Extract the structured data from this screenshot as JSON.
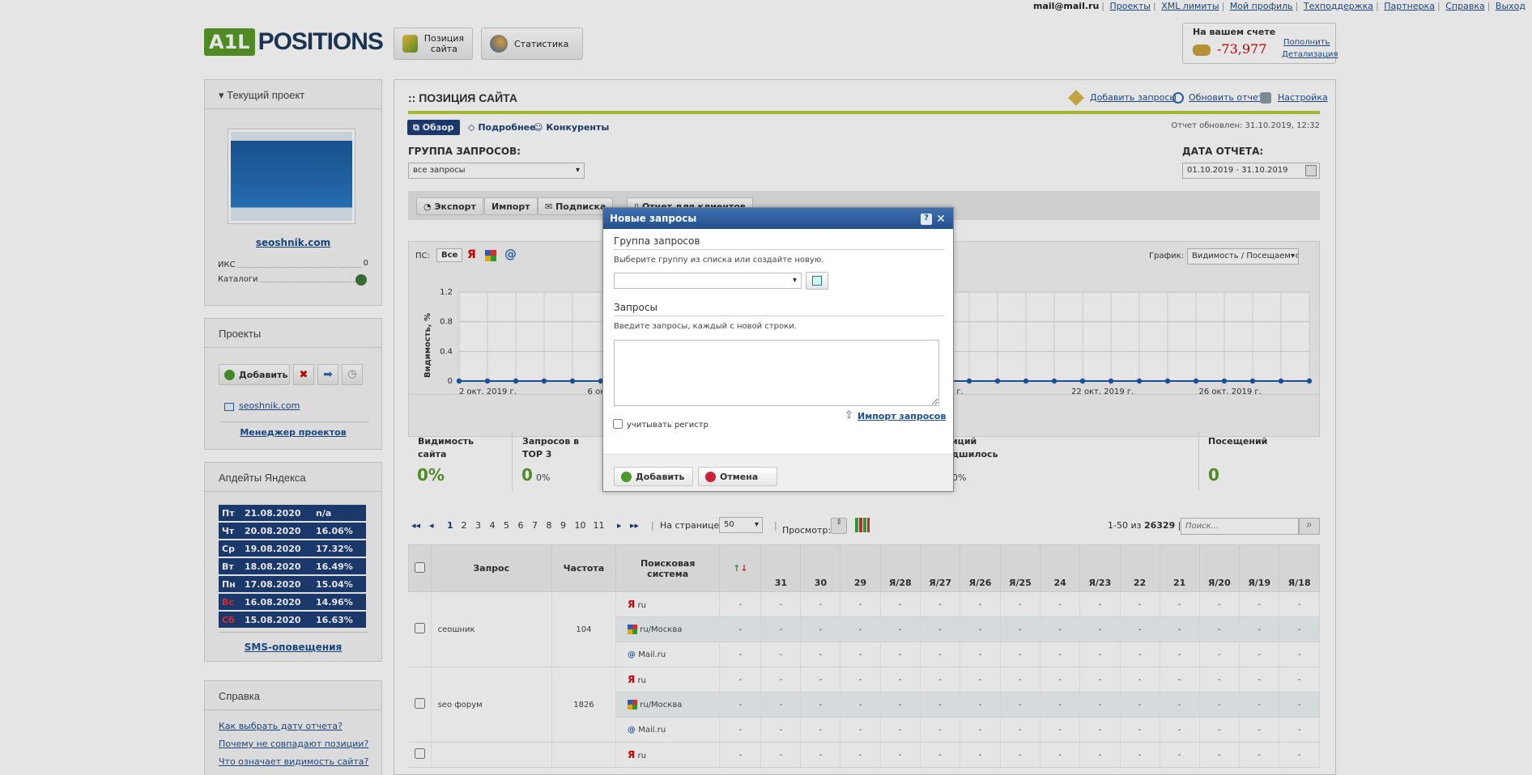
{
  "top_links": {
    "email": "mail@mail.ru",
    "links": [
      "Проекты",
      "XML лимиты",
      "Мой профиль",
      "Техподдержка",
      "Партнерка",
      "Справка",
      "Выход"
    ]
  },
  "logo": {
    "mark": "A1L",
    "text": "POSITIONS"
  },
  "nav": {
    "positions_line1": "Позиция",
    "positions_line2": "сайта",
    "statistics": "Статистика"
  },
  "balance": {
    "label": "На вашем счете",
    "amount": "-73,977",
    "topup": "Пополнить",
    "details": "Детализация"
  },
  "current_project": {
    "header": "Текущий проект",
    "site": "seoshnik.com",
    "iks_label": "ИКС",
    "iks_value": "0",
    "catalogs_label": "Каталоги"
  },
  "projects": {
    "header": "Проекты",
    "add": "Добавить",
    "item": "seoshnik.com",
    "manager": "Менеджер проектов"
  },
  "yandex_updates": {
    "header": "Апдейты Яндекса",
    "rows": [
      {
        "day": "Пт",
        "date": "21.08.2020",
        "value": "n/a",
        "weekend": false
      },
      {
        "day": "Чт",
        "date": "20.08.2020",
        "value": "16.06%",
        "weekend": false
      },
      {
        "day": "Ср",
        "date": "19.08.2020",
        "value": "17.32%",
        "weekend": false
      },
      {
        "day": "Вт",
        "date": "18.08.2020",
        "value": "16.49%",
        "weekend": false
      },
      {
        "day": "Пн",
        "date": "17.08.2020",
        "value": "15.04%",
        "weekend": false
      },
      {
        "day": "Вс",
        "date": "16.08.2020",
        "value": "14.96%",
        "weekend": true
      },
      {
        "day": "Сб",
        "date": "15.08.2020",
        "value": "16.63%",
        "weekend": true
      }
    ],
    "sms": "SMS-оповещения"
  },
  "help": {
    "header": "Справка",
    "links": [
      "Как выбрать дату отчета?",
      "Почему не совпадают позиции?",
      "Что означает видимость сайта?"
    ]
  },
  "main": {
    "title": ":: ПОЗИЦИЯ САЙТА",
    "actions": [
      "Добавить запросы",
      "Обновить отчет",
      "Настройка"
    ],
    "tabs": [
      "Обзор",
      "Подробнее",
      "Конкуренты"
    ],
    "report_updated": "Отчет обновлен: 31.10.2019, 12:32",
    "group_label": "ГРУППА ЗАПРОСОВ:",
    "group_value": "все запросы",
    "date_label": "ДАТА ОТЧЕТА:",
    "date_value": "01.10.2019 - 31.10.2019",
    "toolbar": [
      "Экспорт",
      "Импорт",
      "Подписка",
      "Отчет для клиентов"
    ],
    "ps_label": "ПС:",
    "ps_all": "Все",
    "graph_label": "График:",
    "graph_value": "Видимость / Посещаемость"
  },
  "chart_data": {
    "type": "line",
    "ylabel": "Видимость, %",
    "ylim": [
      0,
      1.2
    ],
    "yticks": [
      "1.2",
      "0.8",
      "0.4",
      "0"
    ],
    "xticks": [
      "2 окт. 2019 г.",
      "6 окт.",
      "19 г.",
      "22 окт. 2019 г.",
      "26 окт. 2019 г."
    ],
    "series": [
      {
        "values": [
          0,
          0,
          0,
          0,
          0,
          0,
          0,
          0,
          0,
          0,
          0,
          0,
          0,
          0,
          0,
          0,
          0,
          0,
          0,
          0,
          0,
          0,
          0,
          0,
          0,
          0,
          0,
          0,
          0,
          0,
          0
        ]
      }
    ]
  },
  "stats": {
    "visibility_line1": "Видимость",
    "visibility_line2": "сайта",
    "visibility_value": "0%",
    "top3_line1": "Запросов в",
    "top3_line2": "TOP 3",
    "top3_value": "0",
    "top3_pct": "0%",
    "pos_line1": "виций",
    "pos_line2": "удшилось",
    "pos_pct": "0%",
    "visits_label": "Посещений",
    "visits_value": "0"
  },
  "pager": {
    "pages": [
      "1",
      "2",
      "3",
      "4",
      "5",
      "6",
      "7",
      "8",
      "9",
      "10",
      "11"
    ],
    "per_page_label": "На странице:",
    "per_page": "50",
    "view_label": "Просмотр:",
    "range": "1-50 из",
    "total": "26329",
    "search_placeholder": "Поиск..."
  },
  "table": {
    "headers": {
      "query": "Запрос",
      "freq": "Частота",
      "engine_line1": "Поисковая",
      "engine_line2": "система"
    },
    "days": [
      "31",
      "30",
      "29",
      "Я/28",
      "Я/27",
      "Я/26",
      "Я/25",
      "24",
      "Я/23",
      "22",
      "21",
      "Я/20",
      "Я/19",
      "Я/18"
    ],
    "rows": [
      {
        "query": "сеошник",
        "freq": "104",
        "engines": [
          "ru",
          "ru/Москва",
          "Mail.ru"
        ]
      },
      {
        "query": "seo форум",
        "freq": "1826",
        "engines": [
          "ru",
          "ru/Москва",
          "Mail.ru"
        ]
      },
      {
        "query": "",
        "freq": "",
        "engines": [
          "ru"
        ]
      }
    ],
    "dash": "-"
  },
  "modal": {
    "title": "Новые запросы",
    "group_title": "Группа запросов",
    "group_hint": "Выберите группу из списка или создайте новую.",
    "queries_title": "Запросы",
    "queries_hint": "Введите запросы, каждый с новой строки.",
    "import": "Импорт запросов",
    "case_label": "учитывать регистр",
    "add": "Добавить",
    "cancel": "Отмена"
  }
}
